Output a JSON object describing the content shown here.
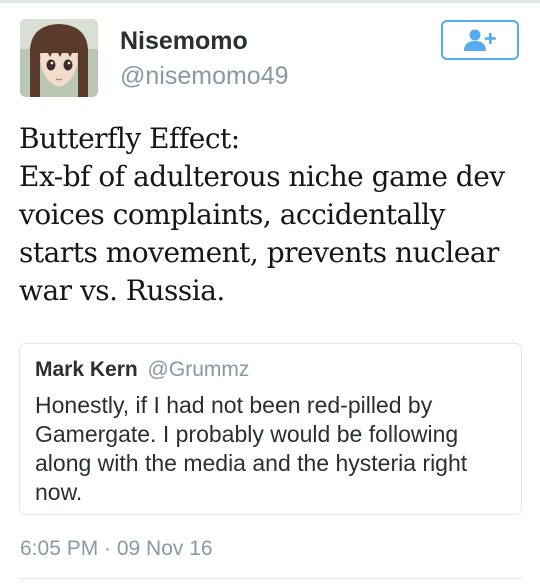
{
  "profile": {
    "display_name": "Nisemomo",
    "handle": "@nisemomo49",
    "avatar_icon": "anime-girl-avatar",
    "follow_icon": "add-user-icon"
  },
  "tweet": {
    "lines": [
      "Butterfly Effect:",
      "Ex-bf of adulterous niche game dev",
      "voices complaints, accidentally",
      "starts movement, prevents nuclear",
      "war vs. Russia."
    ],
    "timestamp": "6:05 PM · 09 Nov 16"
  },
  "quote": {
    "name": "Mark Kern",
    "handle": "@Grummz",
    "lines": [
      "Honestly, if I had not been red-pilled by",
      "Gamergate. I probably would be following",
      "along with the media and the hysteria right",
      "now."
    ]
  },
  "colors": {
    "accent": "#55acee",
    "secondary_text": "#8899a6",
    "primary_text": "#292f33",
    "border": "#e1e8ed"
  }
}
